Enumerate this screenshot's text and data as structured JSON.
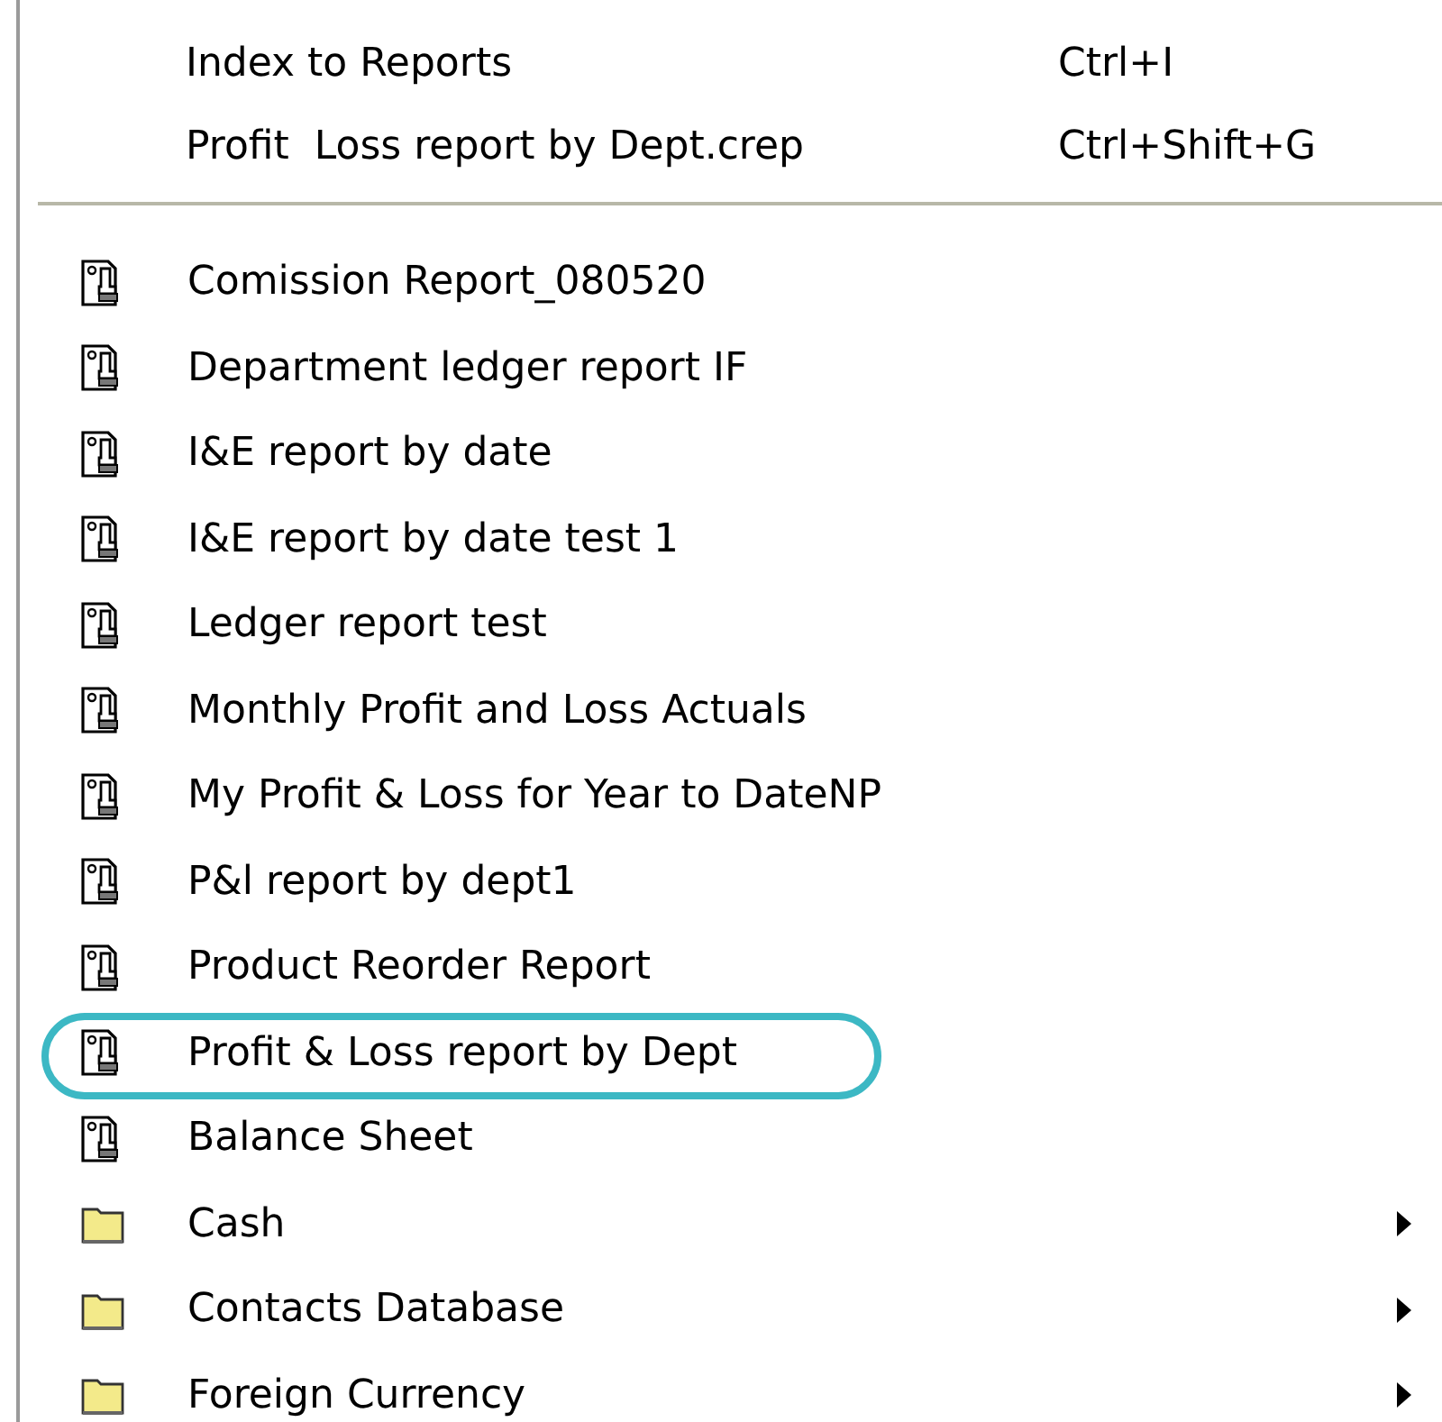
{
  "commands": [
    {
      "label": "Index to Reports",
      "shortcut": "Ctrl+I"
    },
    {
      "label": "Profit  Loss report by Dept.crep",
      "shortcut": "Ctrl+Shift+G"
    }
  ],
  "items": [
    {
      "kind": "report",
      "label": "Comission Report_080520",
      "circled": false
    },
    {
      "kind": "report",
      "label": "Department ledger report IF",
      "circled": false
    },
    {
      "kind": "report",
      "label": "I&E report by date",
      "circled": false
    },
    {
      "kind": "report",
      "label": "I&E report by date test 1",
      "circled": false
    },
    {
      "kind": "report",
      "label": "Ledger report test",
      "circled": false
    },
    {
      "kind": "report",
      "label": "Monthly Profit and Loss Actuals",
      "circled": false
    },
    {
      "kind": "report",
      "label": "My Profit & Loss for Year to DateNP",
      "circled": false
    },
    {
      "kind": "report",
      "label": "P&l report by dept1",
      "circled": false
    },
    {
      "kind": "report",
      "label": "Product Reorder Report",
      "circled": false
    },
    {
      "kind": "report",
      "label": "Profit & Loss report by Dept",
      "circled": true
    },
    {
      "kind": "report",
      "label": "Balance Sheet",
      "circled": false
    },
    {
      "kind": "folder",
      "label": "Cash",
      "circled": false
    },
    {
      "kind": "folder",
      "label": "Contacts Database",
      "circled": false
    },
    {
      "kind": "folder",
      "label": "Foreign Currency",
      "circled": false
    }
  ]
}
